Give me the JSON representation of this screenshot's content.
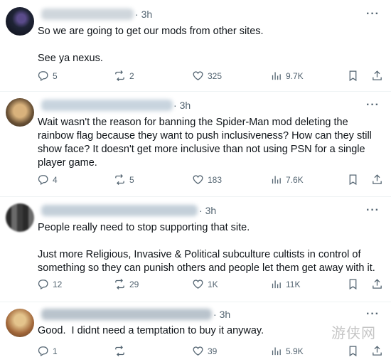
{
  "tweets": [
    {
      "time": "3h",
      "text": "So we are going to get our mods from other sites.\n\nSee ya nexus.",
      "replies": "5",
      "reposts": "2",
      "likes": "325",
      "views": "9.7K"
    },
    {
      "time": "3h",
      "text": "Wait wasn't the reason for banning the Spider-Man mod deleting the rainbow flag because they want to push inclusiveness? How can they still show face? It doesn't get more inclusive than not using PSN for a single player game.",
      "replies": "4",
      "reposts": "5",
      "likes": "183",
      "views": "7.6K"
    },
    {
      "time": "3h",
      "text": "People really need to stop supporting that site.\n\nJust more Religious, Invasive & Political subculture cultists in control of something so they can punish others and people let them get away with it.",
      "replies": "12",
      "reposts": "29",
      "likes": "1K",
      "views": "11K"
    },
    {
      "time": "3h",
      "text": "Good.  I didnt need a temptation to buy it anyway.",
      "replies": "1",
      "reposts": "",
      "likes": "39",
      "views": "5.9K"
    }
  ],
  "watermark": "游侠网",
  "icons": {
    "reply": "reply-icon",
    "repost": "repost-icon",
    "like": "like-icon",
    "views": "views-icon",
    "bookmark": "bookmark-icon",
    "share": "share-icon",
    "more": "more-icon"
  },
  "colors": {
    "text": "#0f1419",
    "muted": "#536471",
    "divider": "#eff3f4"
  }
}
